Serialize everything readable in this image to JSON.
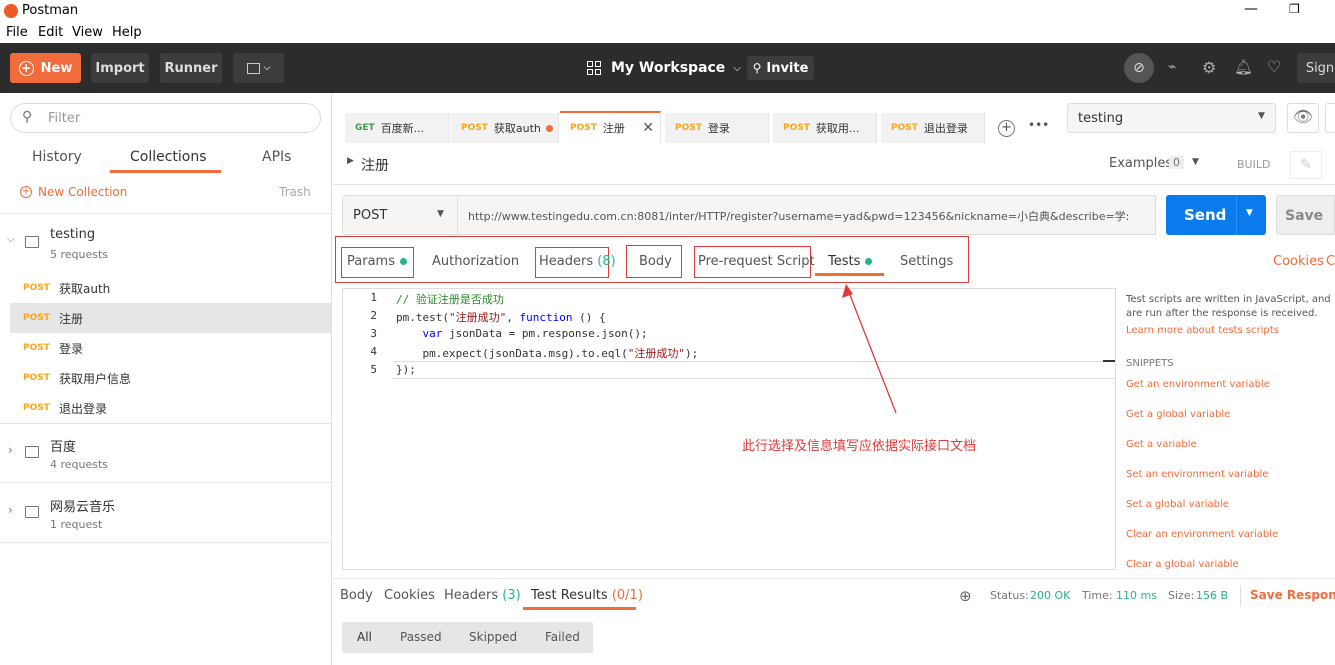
{
  "window": {
    "title": "Postman"
  },
  "menu": [
    "File",
    "Edit",
    "View",
    "Help"
  ],
  "toolbar": {
    "new": "New",
    "import": "Import",
    "runner": "Runner",
    "workspace": "My Workspace",
    "invite": "Invite",
    "sign": "Sign"
  },
  "sidebar": {
    "filter_placeholder": "Filter",
    "tabs": [
      "History",
      "Collections",
      "APIs"
    ],
    "new_collection": "New Collection",
    "trash": "Trash",
    "collections": [
      {
        "name": "testing",
        "count": "5 requests",
        "items": [
          {
            "method": "POST",
            "name": "获取auth"
          },
          {
            "method": "POST",
            "name": "注册"
          },
          {
            "method": "POST",
            "name": "登录"
          },
          {
            "method": "POST",
            "name": "获取用户信息"
          },
          {
            "method": "POST",
            "name": "退出登录"
          }
        ]
      },
      {
        "name": "百度",
        "count": "4 requests"
      },
      {
        "name": "网易云音乐",
        "count": "1 request"
      }
    ]
  },
  "tabs": [
    {
      "method": "GET",
      "name": "百度新..."
    },
    {
      "method": "POST",
      "name": "获取auth"
    },
    {
      "method": "POST",
      "name": "注册"
    },
    {
      "method": "POST",
      "name": "登录"
    },
    {
      "method": "POST",
      "name": "获取用..."
    },
    {
      "method": "POST",
      "name": "退出登录"
    }
  ],
  "environment": "testing",
  "request": {
    "title": "注册",
    "examples_label": "Examples",
    "examples_count": "0",
    "build": "BUILD",
    "method": "POST",
    "url": "http://www.testingedu.com.cn:8081/inter/HTTP/register?username=yad&pwd=123456&nickname=小白典&describe=学:",
    "send": "Send",
    "save": "Save"
  },
  "subtabs": {
    "params": "Params",
    "authorization": "Authorization",
    "headers": "Headers",
    "headers_count": "(8)",
    "body": "Body",
    "prerequest": "Pre-request Script",
    "tests": "Tests",
    "settings": "Settings",
    "cookies": "Cookies",
    "code": "C"
  },
  "code": [
    "// 验证注册是否成功",
    "pm.test(\"注册成功\", function () {",
    "    var jsonData = pm.response.json();",
    "    pm.expect(jsonData.msg).to.eql(\"注册成功\");",
    "});"
  ],
  "line_numbers": [
    "1",
    "2",
    "3",
    "4",
    "5"
  ],
  "annotation": "此行选择及信息填写应依据实际接口文档",
  "help": {
    "intro": "Test scripts are written in JavaScript, and are run after the response is received.",
    "learn": "Learn more about tests scripts",
    "snippets_title": "SNIPPETS",
    "snippets": [
      "Get an environment variable",
      "Get a global variable",
      "Get a variable",
      "Set an environment variable",
      "Set a global variable",
      "Clear an environment variable",
      "Clear a global variable"
    ]
  },
  "response": {
    "tabs": [
      "Body",
      "Cookies",
      "Headers",
      "Test Results"
    ],
    "headers_count": "(3)",
    "test_count": "(0/1)",
    "status_label": "Status:",
    "status": "200 OK",
    "time_label": "Time:",
    "time": "110 ms",
    "size_label": "Size:",
    "size": "156 B",
    "save": "Save Response",
    "filters": [
      "All",
      "Passed",
      "Skipped",
      "Failed"
    ]
  }
}
